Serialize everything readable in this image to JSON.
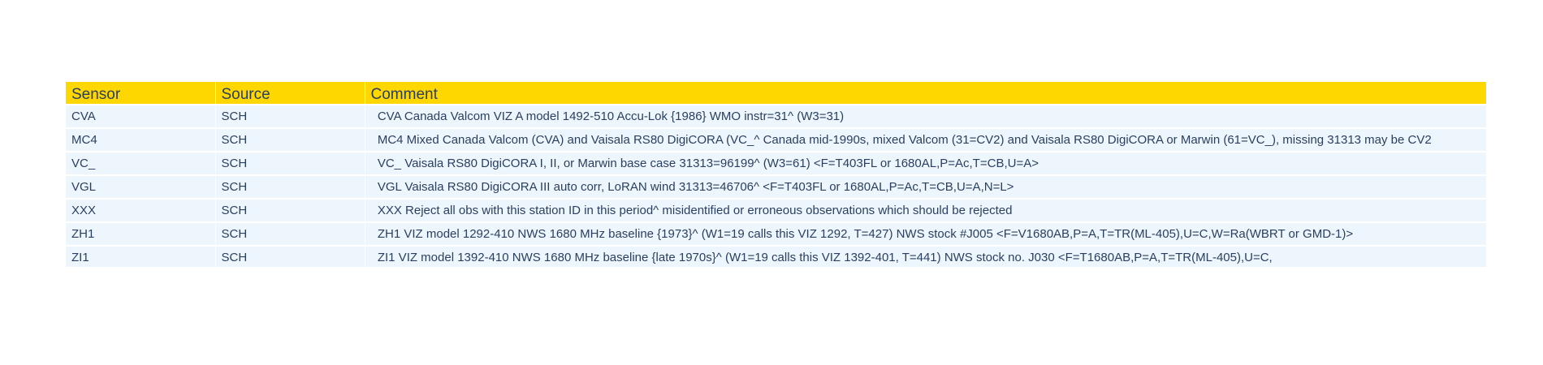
{
  "table": {
    "headers": {
      "sensor": "Sensor",
      "source": "Source",
      "comment": "Comment"
    },
    "rows": [
      {
        "sensor": "CVA",
        "source": "SCH",
        "comment": "  CVA Canada Valcom VIZ A model 1492-510 Accu-Lok {1986} WMO instr=31^ (W3=31)"
      },
      {
        "sensor": "MC4",
        "source": "SCH",
        "comment": "  MC4 Mixed Canada Valcom (CVA) and Vaisala RS80 DigiCORA (VC_^ Canada mid-1990s, mixed Valcom (31=CV2) and Vaisala RS80 DigiCORA or Marwin (61=VC_), missing 31313 may be CV2"
      },
      {
        "sensor": "VC_",
        "source": "SCH",
        "comment": "  VC_ Vaisala RS80 DigiCORA I, II, or Marwin base case 31313=96199^ (W3=61) <F=T403FL or 1680AL,P=Ac,T=CB,U=A>"
      },
      {
        "sensor": "VGL",
        "source": "SCH",
        "comment": "  VGL Vaisala RS80 DigiCORA III auto corr, LoRAN wind 31313=46706^ <F=T403FL or 1680AL,P=Ac,T=CB,U=A,N=L>"
      },
      {
        "sensor": "XXX",
        "source": "SCH",
        "comment": "  XXX Reject all obs with this station ID in this period^ misidentified or erroneous observations which should be rejected"
      },
      {
        "sensor": "ZH1",
        "source": "SCH",
        "comment": "  ZH1 VIZ model 1292-410 NWS 1680 MHz baseline {1973}^ (W1=19 calls this VIZ 1292, T=427) NWS stock #J005 <F=V1680AB,P=A,T=TR(ML-405),U=C,W=Ra(WBRT or GMD-1)>"
      },
      {
        "sensor": "ZI1",
        "source": "SCH",
        "comment": "  ZI1 VIZ model 1392-410 NWS 1680 MHz baseline {late 1970s}^ (W1=19 calls this VIZ 1392-401, T=441) NWS stock no. J030 <F=T1680AB,P=A,T=TR(ML-405),U=C,"
      }
    ]
  },
  "colors": {
    "header_bg": "#ffd700",
    "cell_bg": "#eef6fd",
    "text": "#2a3f5f"
  }
}
